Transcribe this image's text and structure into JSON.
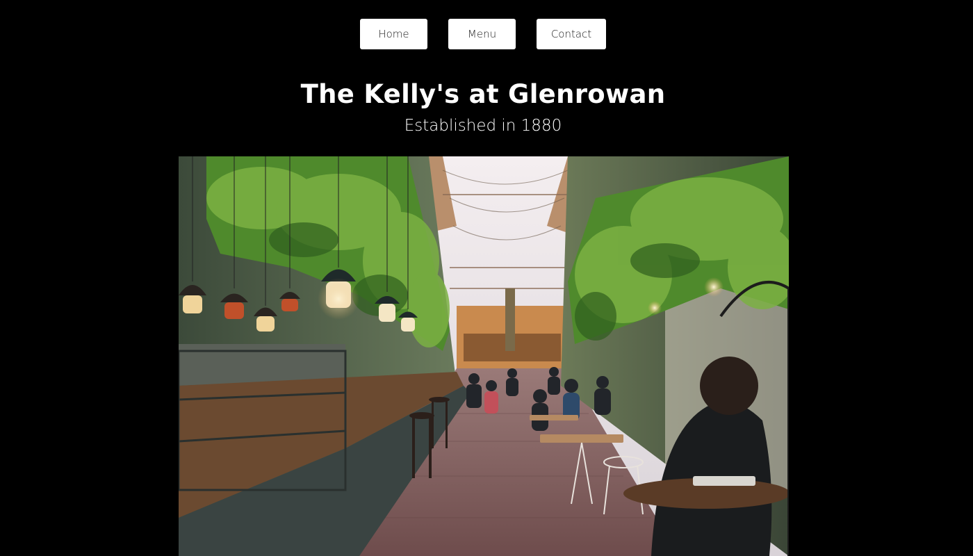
{
  "nav": {
    "home_label": "Home",
    "menu_label": "Menu",
    "contact_label": "Contact"
  },
  "header": {
    "title": "The Kelly's at Glenrowan",
    "subtitle": "Established in 1880"
  },
  "hero_image": {
    "alt": "Covered alley restaurant with hanging plants, pendant lamps, a bar counter and diners at tables"
  },
  "colors": {
    "background": "#000000",
    "text": "#ffffff",
    "button_bg": "#ffffff",
    "button_text": "#1a1a1a"
  }
}
